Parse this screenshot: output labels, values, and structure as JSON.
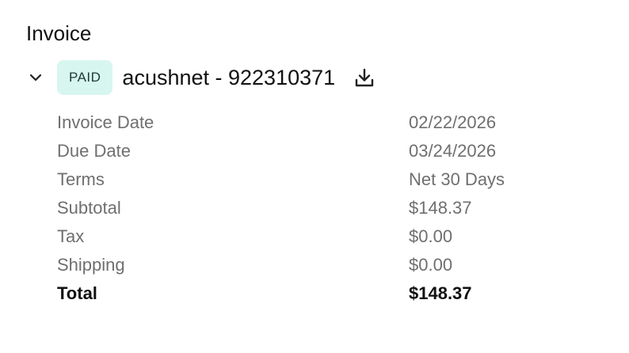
{
  "section": {
    "title": "Invoice"
  },
  "invoice": {
    "status": "PAID",
    "name": "acushnet - 922310371",
    "expand_icon": "chevron-down-icon",
    "download_icon": "download-icon",
    "badge_color": "#d8f6f0",
    "details": [
      {
        "label": "Invoice Date",
        "value": "02/22/2026"
      },
      {
        "label": "Due Date",
        "value": "03/24/2026"
      },
      {
        "label": "Terms",
        "value": "Net 30 Days"
      },
      {
        "label": "Subtotal",
        "value": "$148.37"
      },
      {
        "label": "Tax",
        "value": "$0.00"
      },
      {
        "label": "Shipping",
        "value": "$0.00"
      },
      {
        "label": "Total",
        "value": "$148.37"
      }
    ]
  }
}
